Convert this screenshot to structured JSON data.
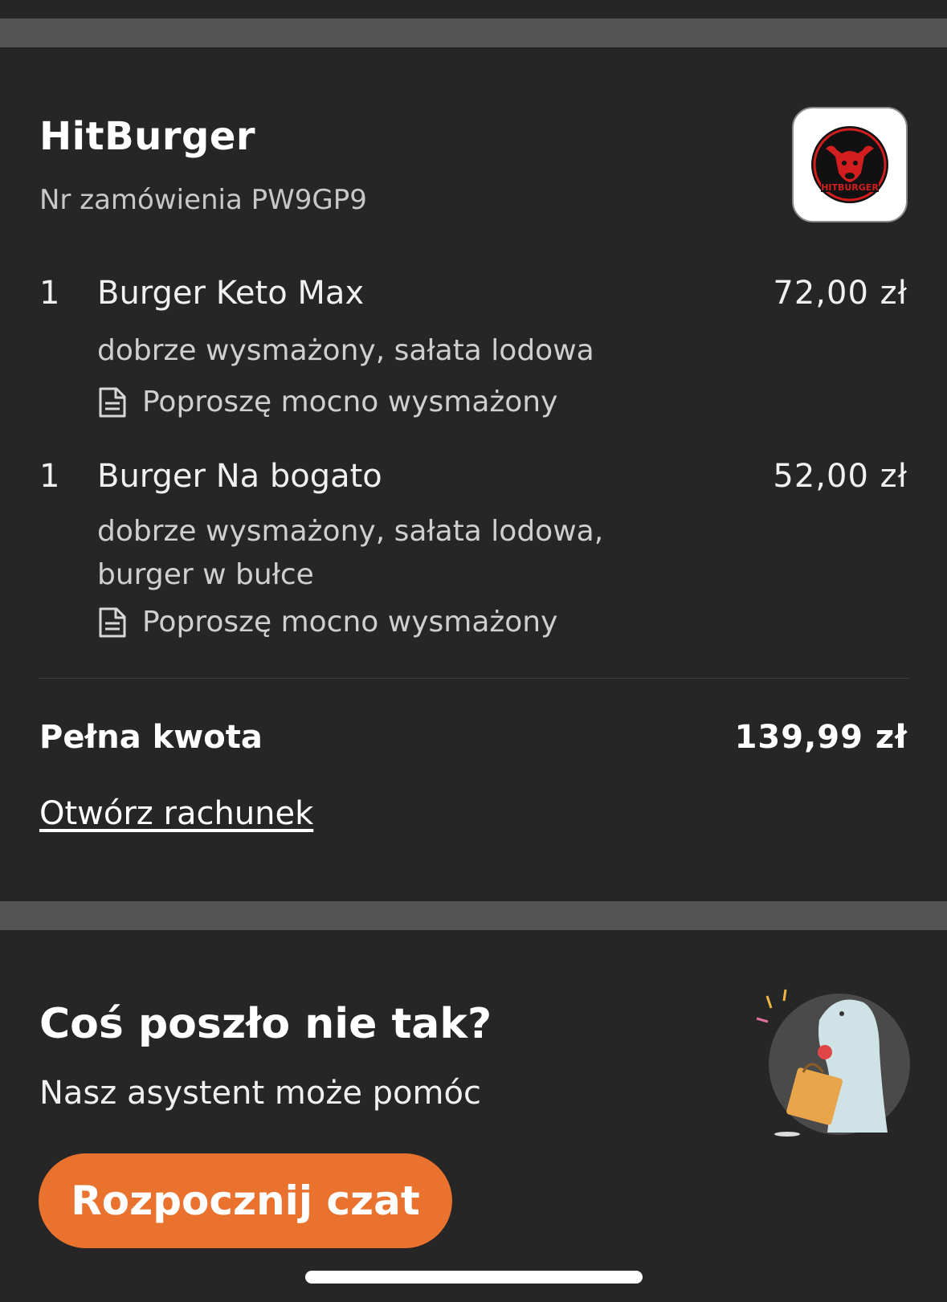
{
  "order": {
    "restaurant_name": "HitBurger",
    "order_number_text": "Nr zamówienia PW9GP9",
    "logo_text": "HITBURGER",
    "items": [
      {
        "qty": "1",
        "name": "Burger Keto Max",
        "price": "72,00 zł",
        "options": "dobrze wysmażony, sałata lodowa",
        "note": "Poproszę mocno wysmażony"
      },
      {
        "qty": "1",
        "name": "Burger Na bogato",
        "price": "52,00 zł",
        "options": "dobrze wysmażony, sałata lodowa, burger w bułce",
        "note": "Poproszę mocno wysmażony"
      }
    ],
    "total_label": "Pełna kwota",
    "total_value": "139,99 zł",
    "receipt_link": "Otwórz rachunek"
  },
  "help": {
    "title": "Coś poszło nie tak?",
    "subtitle": "Nasz asystent może pomóc",
    "chat_button": "Rozpocznij czat"
  },
  "colors": {
    "background": "#262626",
    "divider": "#545454",
    "accent": "#e8722e"
  },
  "icons": [
    "note-icon",
    "restaurant-logo",
    "assistant-illustration"
  ]
}
